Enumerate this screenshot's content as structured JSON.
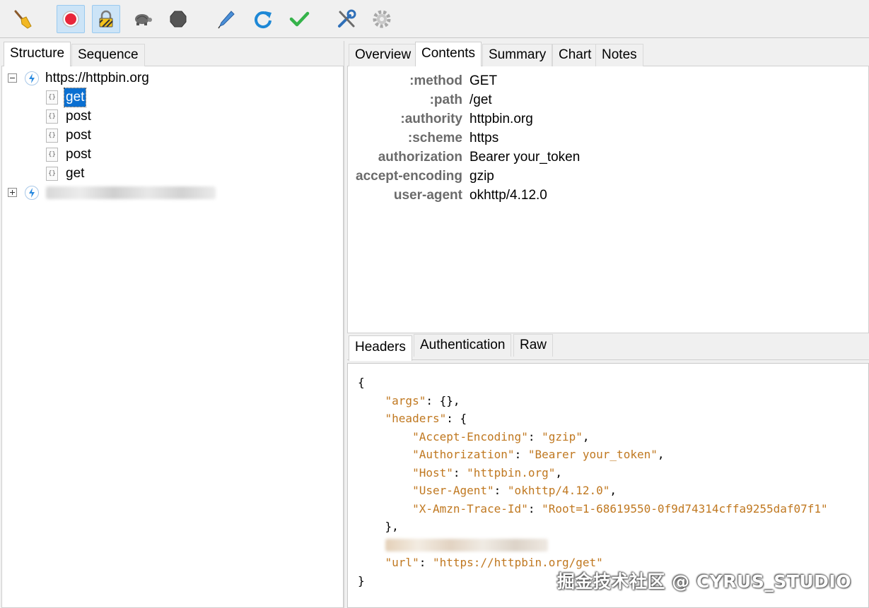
{
  "toolbar": {
    "buttons": [
      {
        "icon": "broom-icon"
      },
      {
        "icon": "record-icon",
        "active": true
      },
      {
        "icon": "ssl-lock-icon",
        "active": true
      },
      {
        "icon": "turtle-throttle-icon"
      },
      {
        "icon": "breakpoint-hexagon-icon"
      },
      {
        "icon": "pen-compose-icon"
      },
      {
        "icon": "repeat-icon"
      },
      {
        "icon": "validate-check-icon"
      },
      {
        "icon": "tools-icon"
      },
      {
        "icon": "settings-gear-icon"
      }
    ]
  },
  "left_tabs": {
    "structure": "Structure",
    "sequence": "Sequence"
  },
  "tree": {
    "host1": "https://httpbin.org",
    "requests": [
      "get",
      "post",
      "post",
      "post",
      "get"
    ],
    "selected_index": 0
  },
  "right_tabs": {
    "overview": "Overview",
    "contents": "Contents",
    "summary": "Summary",
    "chart": "Chart",
    "notes": "Notes"
  },
  "request_headers": [
    {
      "key": ":method",
      "value": "GET"
    },
    {
      "key": ":path",
      "value": "/get"
    },
    {
      "key": ":authority",
      "value": "httpbin.org"
    },
    {
      "key": ":scheme",
      "value": "https"
    },
    {
      "key": "authorization",
      "value": "Bearer your_token"
    },
    {
      "key": "accept-encoding",
      "value": "gzip"
    },
    {
      "key": "user-agent",
      "value": "okhttp/4.12.0"
    }
  ],
  "lower_tabs": {
    "headers": "Headers",
    "authentication": "Authentication",
    "raw": "Raw"
  },
  "response_json": {
    "open_brace": "{",
    "args_key": "\"args\"",
    "args_value": "{},",
    "headers_key": "\"headers\"",
    "headers_open": "{",
    "header_lines": [
      {
        "key": "\"Accept-Encoding\"",
        "value": "\"gzip\"",
        "comma": ","
      },
      {
        "key": "\"Authorization\"",
        "value": "\"Bearer your_token\"",
        "comma": ","
      },
      {
        "key": "\"Host\"",
        "value": "\"httpbin.org\"",
        "comma": ","
      },
      {
        "key": "\"User-Agent\"",
        "value": "\"okhttp/4.12.0\"",
        "comma": ","
      },
      {
        "key": "\"X-Amzn-Trace-Id\"",
        "value": "\"Root=1-68619550-0f9d74314cffa9255daf07f1\"",
        "comma": ""
      }
    ],
    "headers_close": "},",
    "url_key": "\"url\"",
    "url_value": "\"https://httpbin.org/get\"",
    "close_brace": "}"
  },
  "watermark": "掘金技术社区 @ CYRUS_STUDIO"
}
